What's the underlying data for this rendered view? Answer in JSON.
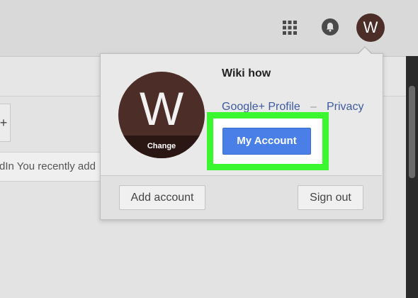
{
  "header": {
    "apps_icon": "apps-grid-icon",
    "notifications_icon": "bell-icon",
    "avatar_letter": "W"
  },
  "background": {
    "tab_plus": "+",
    "recent_notice": "dIn You recently add"
  },
  "account_popup": {
    "avatar_letter": "W",
    "change_label": "Change",
    "user_name": "Wiki how",
    "profile_link": "Google+ Profile",
    "separator": "–",
    "privacy_link": "Privacy",
    "my_account_button": "My Account",
    "add_account_button": "Add account",
    "sign_out_button": "Sign out"
  },
  "colors": {
    "avatar": "#4c2d27",
    "link": "#3d5a9f",
    "primary_button": "#4a7fe8",
    "highlight": "#3af72f"
  }
}
